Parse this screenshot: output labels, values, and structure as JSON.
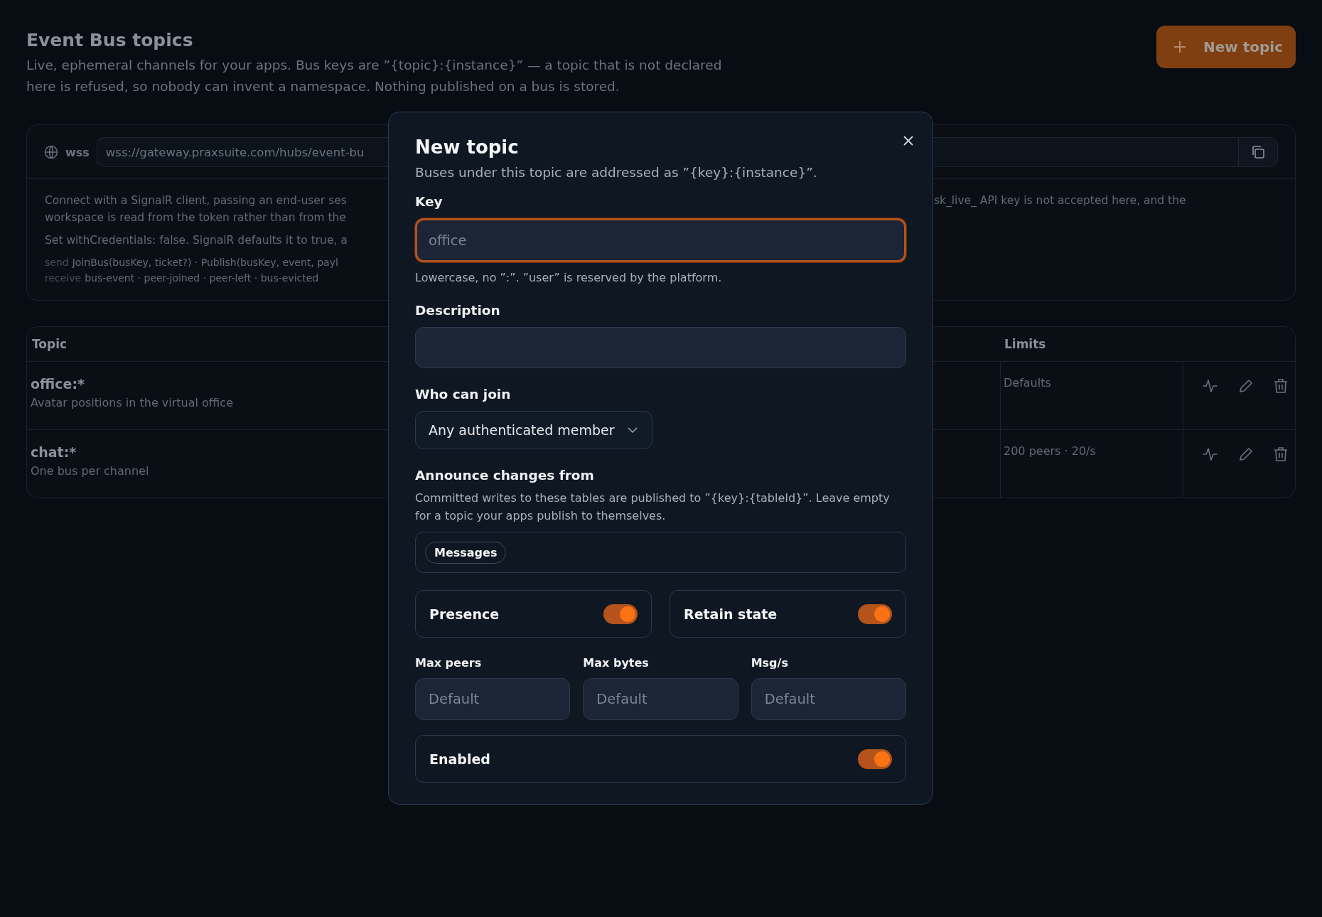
{
  "page": {
    "title": "Event Bus topics",
    "description": "Live, ephemeral channels for your apps. Bus keys are ”{topic}:{instance}” — a topic that is not declared here is refused, so nobody can invent a namespace. Nothing published on a bus is stored."
  },
  "new_topic_button": {
    "label": "New topic"
  },
  "connection": {
    "scheme": "wss",
    "url": "wss://gateway.praxsuite.com/hubs/event-bu",
    "notes": [
      {
        "left": "Connect with a SignalR client, passing an end-user ses",
        "right": "sk_live_ API key is not accepted here, and the"
      },
      {
        "left": "workspace is read from the token rather than from the"
      },
      {
        "left": "Set withCredentials: false. SignalR defaults it to true, a"
      }
    ],
    "methods": [
      {
        "label": "send",
        "items": "JoinBus(busKey, ticket?) · Publish(busKey, event, payl"
      },
      {
        "label": "receive",
        "items": "bus-event · peer-joined · peer-left · bus-evicted"
      }
    ]
  },
  "table": {
    "columns": [
      {
        "label": "Topic"
      },
      {
        "label": "Limits"
      }
    ],
    "rows": [
      {
        "topic": "office:*",
        "description": "Avatar positions in the virtual office",
        "limits": "Defaults"
      },
      {
        "topic": "chat:*",
        "description": "One bus per channel",
        "limits": "200 peers · 20/s"
      }
    ]
  },
  "dialog": {
    "title": "New topic",
    "subtitle": "Buses under this topic are addressed as ”{key}:{instance}”.",
    "key": {
      "label": "Key",
      "placeholder": "office",
      "focused": true,
      "hint": "Lowercase, no ”:”. ”user” is reserved by the platform."
    },
    "description": {
      "label": "Description"
    },
    "who_can_join": {
      "label": "Who can join",
      "value": "Any authenticated member"
    },
    "announce": {
      "label": "Announce changes from",
      "help": "Committed writes to these tables are published to ”{key}:{tableId}”. Leave empty for a topic your apps publish to themselves.",
      "tags": [
        "Messages"
      ]
    },
    "toggles": [
      {
        "label": "Presence",
        "on": true
      },
      {
        "label": "Retain state",
        "on": true
      }
    ],
    "limits": [
      {
        "label": "Max peers",
        "placeholder": "Default"
      },
      {
        "label": "Max bytes",
        "placeholder": "Default"
      },
      {
        "label": "Msg/s",
        "placeholder": "Default"
      }
    ],
    "enabled": {
      "label": "Enabled",
      "on": true
    }
  }
}
